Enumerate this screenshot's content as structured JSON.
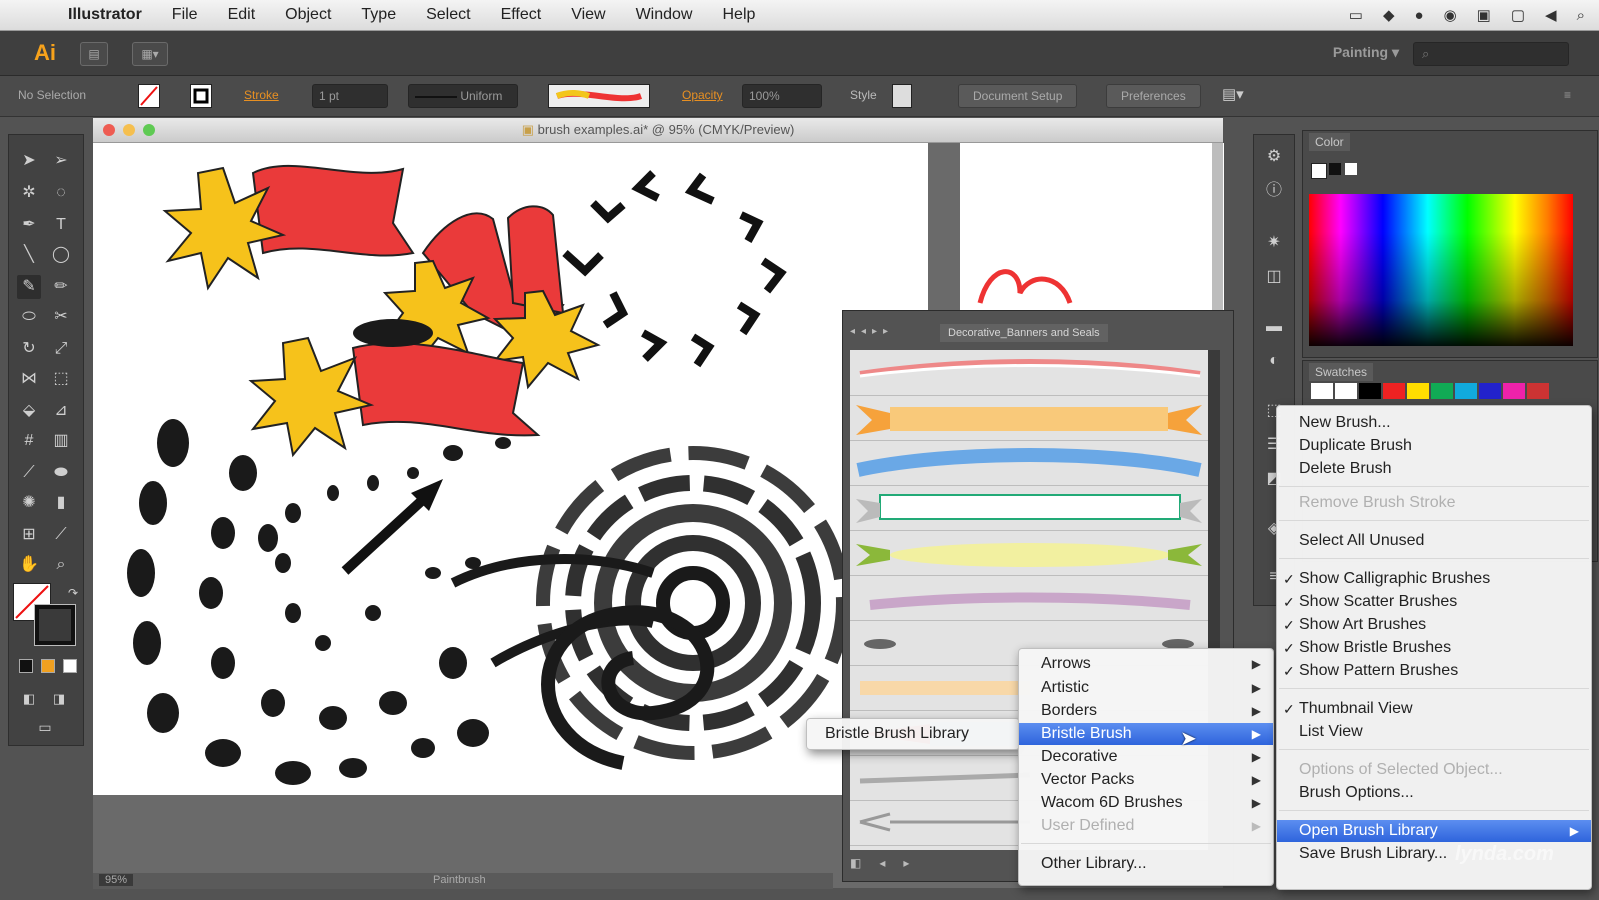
{
  "menubar": {
    "apple_icon": "apple-icon",
    "items": [
      "Illustrator",
      "File",
      "Edit",
      "Object",
      "Type",
      "Select",
      "Effect",
      "View",
      "Window",
      "Help"
    ]
  },
  "appbar": {
    "logo": "Ai",
    "workspace": "Painting",
    "search_placeholder": ""
  },
  "controlbar": {
    "selection": "No Selection",
    "stroke_label": "Stroke",
    "stroke_value": "1 pt",
    "profile": "Uniform",
    "opacity_label": "Opacity",
    "opacity_value": "100%",
    "style_label": "Style",
    "document_setup": "Document Setup",
    "preferences": "Preferences"
  },
  "document": {
    "title": "brush examples.ai* @ 95% (CMYK/Preview)",
    "zoom": "95%",
    "status": "Paintbrush"
  },
  "panels": {
    "color_tab": "Color",
    "swatches_tab": "Swatches",
    "brush_library_tab": "Decorative_Banners and Seals"
  },
  "submenu_left": {
    "label": "Bristle Brush Library"
  },
  "library_menu": {
    "items": [
      {
        "label": "Arrows",
        "submenu": true
      },
      {
        "label": "Artistic",
        "submenu": true
      },
      {
        "label": "Borders",
        "submenu": true
      },
      {
        "label": "Bristle Brush",
        "submenu": true,
        "selected": true
      },
      {
        "label": "Decorative",
        "submenu": true
      },
      {
        "label": "Vector Packs",
        "submenu": true
      },
      {
        "label": "Wacom 6D Brushes",
        "submenu": true
      },
      {
        "label": "User Defined",
        "submenu": true,
        "disabled": true
      },
      {
        "label": "Other Library..."
      }
    ]
  },
  "brush_menu": {
    "items": [
      {
        "label": "New Brush..."
      },
      {
        "label": "Duplicate Brush"
      },
      {
        "label": "Delete Brush"
      },
      {
        "label": "Remove Brush Stroke",
        "disabled": true
      },
      {
        "label": "Select All Unused"
      },
      {
        "label": "Show Calligraphic Brushes",
        "checked": true
      },
      {
        "label": "Show Scatter Brushes",
        "checked": true
      },
      {
        "label": "Show Art Brushes",
        "checked": true
      },
      {
        "label": "Show Bristle Brushes",
        "checked": true
      },
      {
        "label": "Show Pattern Brushes",
        "checked": true
      },
      {
        "label": "Thumbnail View",
        "checked": true
      },
      {
        "label": "List View"
      },
      {
        "label": "Options of Selected Object...",
        "disabled": true
      },
      {
        "label": "Brush Options..."
      },
      {
        "label": "Open Brush Library",
        "selected": true,
        "submenu": true
      },
      {
        "label": "Save Brush Library..."
      }
    ]
  },
  "watermark": "lynda.com",
  "colors": {
    "accent": "#2e64dc",
    "ai_orange": "#f7a21b",
    "banner_red": "#ea3a3a",
    "seal_yellow": "#f6c21b"
  }
}
